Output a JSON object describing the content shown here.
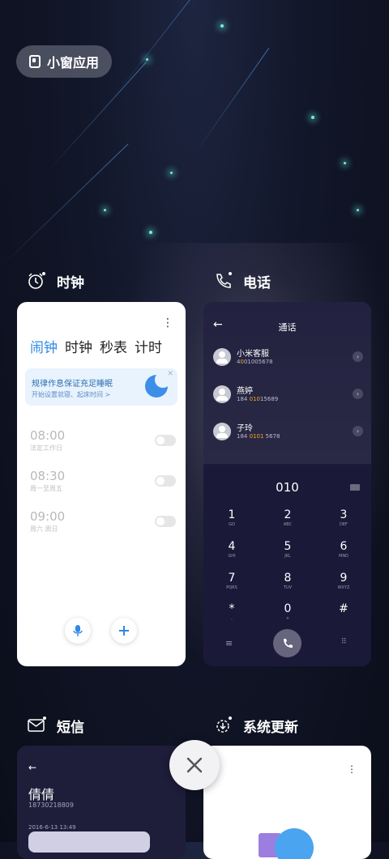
{
  "floating_pill": {
    "label": "小窗应用"
  },
  "apps": [
    {
      "name": "时钟"
    },
    {
      "name": "电话"
    },
    {
      "name": "短信"
    },
    {
      "name": "系统更新"
    }
  ],
  "clock_card": {
    "tabs": [
      "闹钟",
      "时钟",
      "秒表",
      "计时"
    ],
    "active_tab": "闹钟",
    "banner": {
      "title": "规律作息保证充足睡眠",
      "subtitle": "开始设置就寝、起床时间 >"
    },
    "alarms": [
      {
        "time": "08:00",
        "repeat": "法定工作日",
        "enabled": false
      },
      {
        "time": "08:30",
        "repeat": "周一至周五",
        "enabled": false
      },
      {
        "time": "09:00",
        "repeat": "周六 周日",
        "enabled": false
      }
    ]
  },
  "phone_card": {
    "title": "通话",
    "contacts": [
      {
        "name": "小米客服",
        "num_pre": "4",
        "num_hl": "0",
        "num_post": "01005678"
      },
      {
        "name": "燕婷",
        "num_pre": "184 ",
        "num_hl": "010",
        "num_post": "15689"
      },
      {
        "name": "子玲",
        "num_pre": "184 ",
        "num_hl": "0101",
        "num_post": " 5678"
      }
    ],
    "dialed_number": "010",
    "keys": [
      {
        "digit": "1",
        "letters": "GO"
      },
      {
        "digit": "2",
        "letters": "ABC"
      },
      {
        "digit": "3",
        "letters": "DEF"
      },
      {
        "digit": "4",
        "letters": "GHI"
      },
      {
        "digit": "5",
        "letters": "JKL"
      },
      {
        "digit": "6",
        "letters": "MNO"
      },
      {
        "digit": "7",
        "letters": "PQRS"
      },
      {
        "digit": "8",
        "letters": "TUV"
      },
      {
        "digit": "9",
        "letters": "WXYZ"
      },
      {
        "digit": "*",
        "letters": ","
      },
      {
        "digit": "0",
        "letters": "+"
      },
      {
        "digit": "#",
        "letters": ""
      }
    ]
  },
  "sms_card": {
    "contact_name": "倩倩",
    "number": "18730218809",
    "date": "2016-6-13 13:49"
  },
  "colors": {
    "accent": "#2e89e6",
    "highlight": "#f0a830"
  }
}
